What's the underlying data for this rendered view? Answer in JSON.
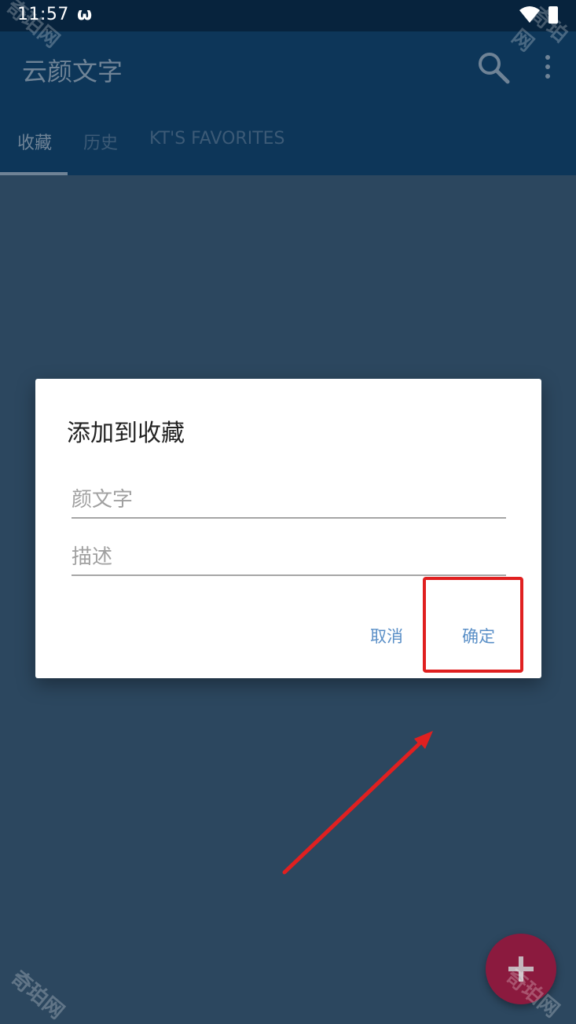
{
  "status_bar": {
    "time": "11:57",
    "app_glyph": "ω"
  },
  "app_bar": {
    "title": "云颜文字",
    "tabs": [
      {
        "label": "收藏",
        "active": true
      },
      {
        "label": "历史",
        "active": false
      },
      {
        "label": "KT'S FAVORITES",
        "active": false
      }
    ]
  },
  "dialog": {
    "title": "添加到收藏",
    "fields": [
      {
        "placeholder": "颜文字",
        "value": ""
      },
      {
        "placeholder": "描述",
        "value": ""
      }
    ],
    "cancel_label": "取消",
    "ok_label": "确定"
  },
  "icons": {
    "search": "search-icon",
    "more": "more-vert-icon",
    "add": "plus-icon",
    "wifi": "wifi-icon",
    "battery": "battery-icon"
  },
  "watermark": "奇珀网",
  "colors": {
    "app_bar": "#0d3659",
    "status_bar": "#07233d",
    "scrim_background": "#2c475f",
    "accent_button": "#5a8fc7",
    "fab": "#8b1a3e",
    "highlight": "#e02020"
  }
}
